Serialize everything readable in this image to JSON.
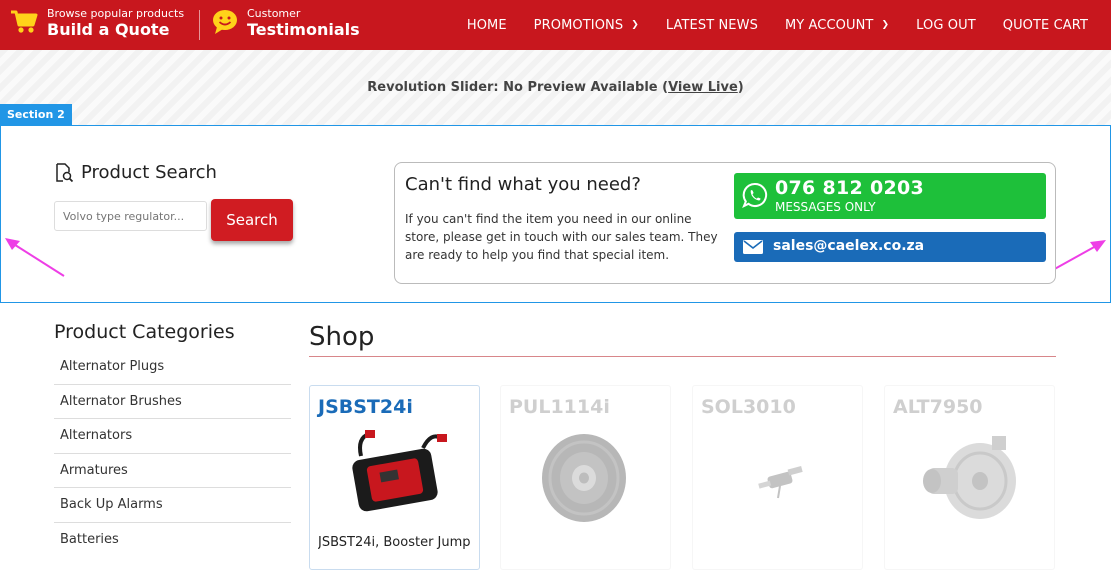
{
  "topbar": {
    "quote_small": "Browse popular products",
    "quote_big": "Build a Quote",
    "testimonial_small": "Customer",
    "testimonial_big": "Testimonials",
    "nav": [
      "HOME",
      "PROMOTIONS",
      "LATEST NEWS",
      "MY ACCOUNT",
      "LOG OUT",
      "QUOTE CART"
    ]
  },
  "slider": {
    "message": "Revolution Slider: No Preview Available",
    "open_paren": " (",
    "link": "View Live",
    "close_paren": ")"
  },
  "section_tag": "Section 2",
  "product_search": {
    "title": "Product Search",
    "placeholder": "Volvo type regulator...",
    "button": "Search"
  },
  "help": {
    "title": "Can't find what you need?",
    "text": "If you can't find the item you need in our online store, please get in touch with our sales team. They are ready to help you find that special item.",
    "phone": "076 812 0203",
    "phone_note": "MESSAGES ONLY",
    "email": "sales@caelex.co.za"
  },
  "categories": {
    "title": "Product Categories",
    "items": [
      "Alternator Plugs",
      "Alternator Brushes",
      "Alternators",
      "Armatures",
      "Back Up Alarms",
      "Batteries"
    ]
  },
  "shop": {
    "title": "Shop",
    "products": [
      {
        "code": "JSBST24i",
        "desc": "JSBST24i, Booster Jump"
      },
      {
        "code": "PUL1114i",
        "desc": ""
      },
      {
        "code": "SOL3010",
        "desc": ""
      },
      {
        "code": "ALT7950",
        "desc": ""
      }
    ]
  },
  "colors": {
    "brand_red": "#c8171e",
    "whatsapp_green": "#1ec03a",
    "email_blue": "#1a6bb8",
    "section_blue": "#2196e6",
    "annotation_magenta": "#ee3ee6"
  }
}
